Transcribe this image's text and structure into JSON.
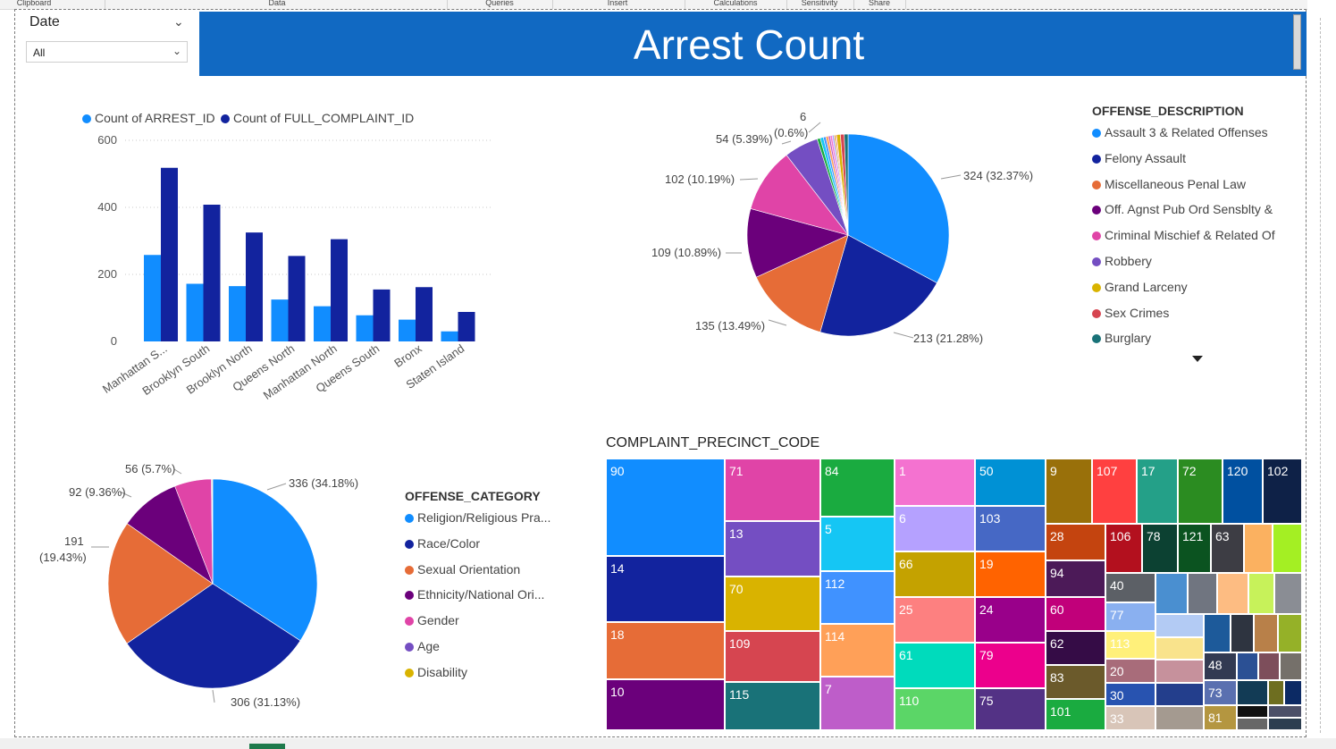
{
  "ribbon": {
    "groups": [
      "Clipboard",
      "Data",
      "Queries",
      "Insert",
      "Calculations",
      "Sensitivity",
      "Share"
    ]
  },
  "slicer": {
    "title": "Date",
    "value": "All"
  },
  "banner": {
    "title": "Arrest Count"
  },
  "bar_chart": {
    "legend": [
      "Count of ARREST_ID",
      "Count of FULL_COMPLAINT_ID"
    ],
    "y_ticks": [
      "600",
      "400",
      "200",
      "0"
    ]
  },
  "pie_offense_description": {
    "legend_title": "OFFENSE_DESCRIPTION",
    "legend": [
      "Assault 3 & Related Offenses",
      "Felony Assault",
      "Miscellaneous Penal Law",
      "Off. Agnst Pub Ord Sensblty &",
      "Criminal Mischief & Related Of",
      "Robbery",
      "Grand Larceny",
      "Sex Crimes",
      "Burglary"
    ],
    "labels": {
      "l324": "324 (32.37%)",
      "l213": "213 (21.28%)",
      "l135": "135 (13.49%)",
      "l109": "109 (10.89%)",
      "l102": "102 (10.19%)",
      "l54": "54 (5.39%)",
      "l6a": "6",
      "l6b": "(0.6%)"
    }
  },
  "pie_offense_category": {
    "legend_title": "OFFENSE_CATEGORY",
    "legend": [
      "Religion/Religious Pra...",
      "Race/Color",
      "Sexual Orientation",
      "Ethnicity/National Ori...",
      "Gender",
      "Age",
      "Disability"
    ],
    "labels": {
      "l336": "336 (34.18%)",
      "l306": "306 (31.13%)",
      "l191a": "191",
      "l191b": "(19.43%)",
      "l92": "92 (9.36%)",
      "l56": "56 (5.7%)"
    }
  },
  "treemap": {
    "title": "COMPLAINT_PRECINCT_CODE",
    "cells": [
      "90",
      "14",
      "18",
      "10",
      "71",
      "13",
      "70",
      "109",
      "115",
      "84",
      "5",
      "112",
      "114",
      "7",
      "1",
      "6",
      "66",
      "25",
      "61",
      "110",
      "50",
      "103",
      "19",
      "24",
      "79",
      "75",
      "9",
      "28",
      "94",
      "60",
      "62",
      "83",
      "101",
      "107",
      "17",
      "72",
      "120",
      "102",
      "106",
      "78",
      "121",
      "63",
      "40",
      "77",
      "113",
      "20",
      "30",
      "33",
      "48",
      "73",
      "81"
    ]
  },
  "chart_data": [
    {
      "type": "bar",
      "categories": [
        "Manhattan S...",
        "Brooklyn South",
        "Brooklyn North",
        "Queens North",
        "Manhattan North",
        "Queens South",
        "Bronx",
        "Staten Island"
      ],
      "series": [
        {
          "name": "Count of ARREST_ID",
          "values": [
            258,
            172,
            165,
            125,
            105,
            78,
            65,
            30
          ],
          "color": "#118dff"
        },
        {
          "name": "Count of FULL_COMPLAINT_ID",
          "values": [
            518,
            408,
            325,
            255,
            305,
            155,
            162,
            88
          ],
          "color": "#12239e"
        }
      ],
      "ylim": [
        0,
        600
      ],
      "yticks": [
        0,
        200,
        400,
        600
      ],
      "legend": "top-left",
      "grid": true
    },
    {
      "type": "pie",
      "title": "OFFENSE_DESCRIPTION",
      "labels": [
        "Assault 3 & Related Offenses",
        "Felony Assault",
        "Miscellaneous Penal Law",
        "Off. Agnst Pub Ord Sensblty &",
        "Criminal Mischief & Related Of",
        "Robbery",
        "Grand Larceny",
        "Sex Crimes",
        "Burglary"
      ],
      "values": [
        324,
        213,
        135,
        109,
        102,
        54,
        6,
        6,
        6
      ],
      "colors": [
        "#118dff",
        "#12239e",
        "#e66c37",
        "#6b007b",
        "#e044a7",
        "#744ec2",
        "#d9b300",
        "#d64550",
        "#197278"
      ],
      "small_slices": [
        {
          "value": 5,
          "color": "#1aab40"
        },
        {
          "value": 5,
          "color": "#15c6f4"
        },
        {
          "value": 4,
          "color": "#4092ff"
        },
        {
          "value": 4,
          "color": "#ffa058"
        },
        {
          "value": 3,
          "color": "#be5dc9"
        },
        {
          "value": 3,
          "color": "#f472d0"
        },
        {
          "value": 3,
          "color": "#b5a1ff"
        },
        {
          "value": 2,
          "color": "#c4a200"
        },
        {
          "value": 2,
          "color": "#ff8080"
        }
      ]
    },
    {
      "type": "pie",
      "title": "OFFENSE_CATEGORY",
      "labels": [
        "Religion/Religious Pra...",
        "Race/Color",
        "Sexual Orientation",
        "Ethnicity/National Ori...",
        "Gender",
        "Age",
        "Disability"
      ],
      "values": [
        336,
        306,
        191,
        92,
        56,
        1,
        1
      ],
      "colors": [
        "#118dff",
        "#12239e",
        "#e66c37",
        "#6b007b",
        "#e044a7",
        "#744ec2",
        "#d9b300"
      ]
    }
  ],
  "colors": {
    "banner": "#1169c2",
    "series_light": "#118dff",
    "series_dark": "#12239e"
  }
}
